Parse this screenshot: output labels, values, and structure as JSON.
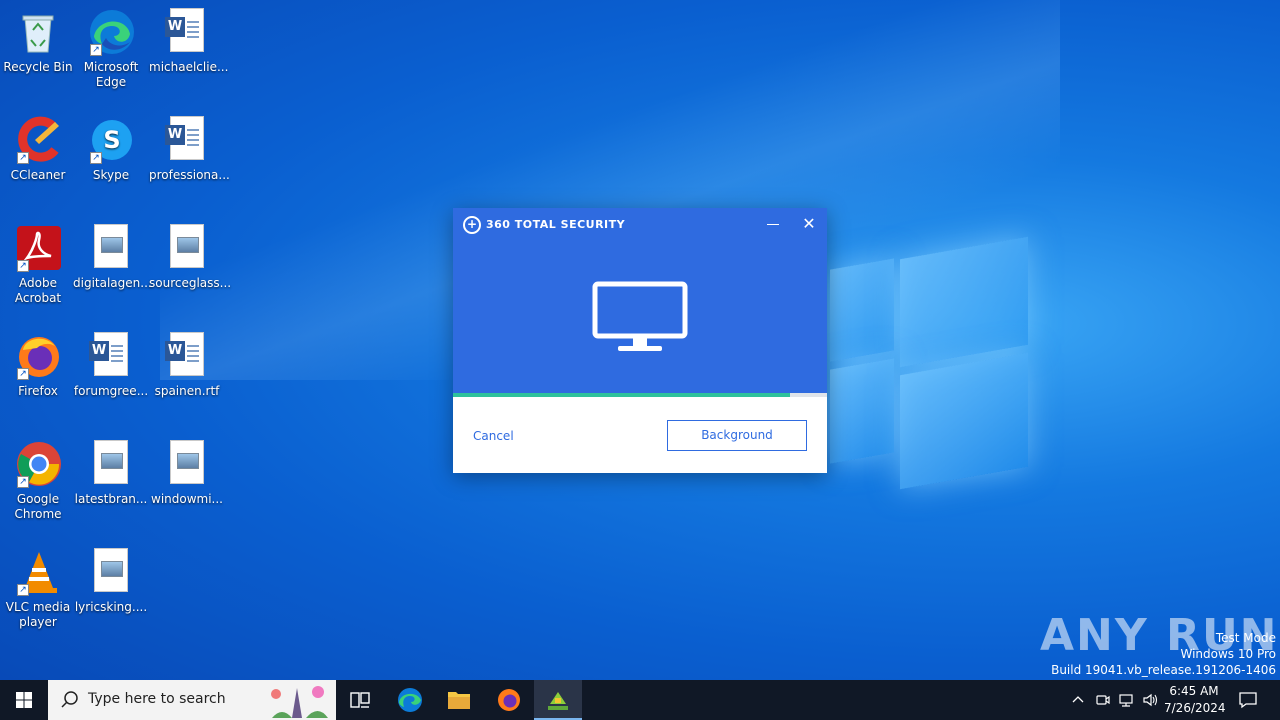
{
  "desktop": {
    "icons": [
      {
        "label": "Recycle Bin"
      },
      {
        "label": "Microsoft Edge"
      },
      {
        "label": "michaelclie..."
      },
      {
        "label": "CCleaner"
      },
      {
        "label": "Skype"
      },
      {
        "label": "professiona..."
      },
      {
        "label": "Adobe Acrobat"
      },
      {
        "label": "digitalagen..."
      },
      {
        "label": "sourceglass..."
      },
      {
        "label": "Firefox"
      },
      {
        "label": "forumgree..."
      },
      {
        "label": "spainen.rtf"
      },
      {
        "label": "Google Chrome"
      },
      {
        "label": "latestbran..."
      },
      {
        "label": "windowmi..."
      },
      {
        "label": "VLC media player"
      },
      {
        "label": "lyricsking...."
      }
    ]
  },
  "dialog": {
    "title": "360 TOTAL SECURITY",
    "progress_fraction": 0.9,
    "cancel_label": "Cancel",
    "background_label": "Background",
    "accent_color": "#2f6be0",
    "progress_color": "#2ec29c"
  },
  "watermark": {
    "logo_text": "ANY RUN",
    "line1": "Test Mode",
    "line2": "Windows 10 Pro",
    "line3": "Build 19041.vb_release.191206-1406"
  },
  "taskbar": {
    "search_placeholder": "Type here to search",
    "time": "6:45 AM",
    "date": "7/26/2024"
  }
}
